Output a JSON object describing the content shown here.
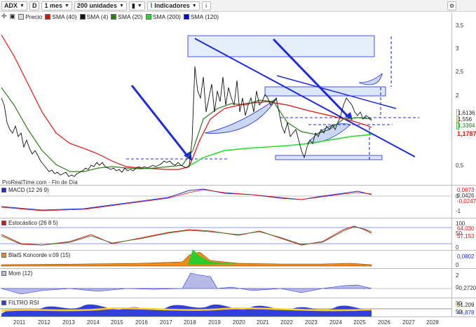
{
  "toolbar": {
    "symbol": "ADX",
    "d_button": "D",
    "period": "1 mes",
    "units": "200 unidades",
    "indicators": "Indicadores",
    "info_icon": "i"
  },
  "legend": {
    "price": "Precio",
    "sma40": "SMA (40)",
    "sma4": "SMA (4)",
    "sma20": "SMA (20)",
    "sma200": "SMA (200)",
    "sma120": "SMA (120)"
  },
  "colors": {
    "sma40": "#e01010",
    "sma4": "#111111",
    "sma20": "#2e7d1e",
    "sma200": "#22dd22",
    "sma120": "#0000ff",
    "trend": "#1c2bdd"
  },
  "watermark": "ProRealTime.com - Fin de Día",
  "price_axis": [
    "3,5",
    "3",
    "2,5",
    "2",
    "0,5"
  ],
  "price_labels": [
    "1,6136",
    "1,556",
    "1,3394",
    "1,1787"
  ],
  "panes": {
    "macd": {
      "title": "MACD (12 26 9)",
      "axis": [
        "0",
        "-1"
      ],
      "labels": [
        "0,0673",
        "0,0426",
        "-0,0247"
      ]
    },
    "stoch": {
      "title": "Estocástico (26 8 5)",
      "axis": [
        "100",
        "50",
        "0"
      ],
      "labels": [
        "64,030",
        "57,153"
      ]
    },
    "koncorde": {
      "title": "BlaiS Koncorde v.09 (15)",
      "axis": [
        "0"
      ],
      "labels": [
        "0,0802"
      ]
    },
    "mom": {
      "title": "Mom (12)",
      "axis": [
        "2",
        "0"
      ],
      "labels": [
        "-0,2720"
      ]
    },
    "rsi": {
      "title": "FILTRO RSI",
      "axis": [
        "80",
        "50"
      ],
      "labels": [
        "51,209",
        "46,878"
      ]
    }
  },
  "x_axis": [
    "2011",
    "2012",
    "2013",
    "2014",
    "2015",
    "2016",
    "2017",
    "2018",
    "2019",
    "2020",
    "2021",
    "2022",
    "2023",
    "2024",
    "2025",
    "2026",
    "2027",
    "2028"
  ]
}
